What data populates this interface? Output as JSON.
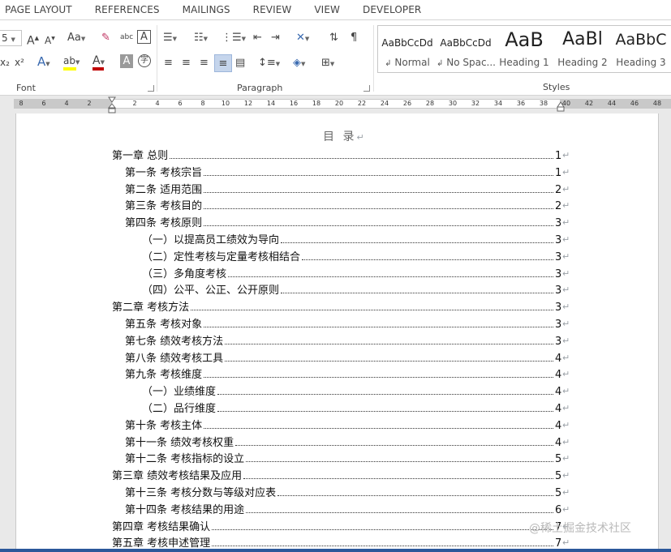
{
  "ribbon_tabs": [
    "PAGE LAYOUT",
    "REFERENCES",
    "MAILINGS",
    "REVIEW",
    "VIEW",
    "DEVELOPER"
  ],
  "font_group": {
    "label": "Font",
    "size_fragment": "5",
    "font_case": "Aa",
    "subscript": "x₂",
    "superscript": "x²"
  },
  "paragraph_group": {
    "label": "Paragraph"
  },
  "styles_group": {
    "label": "Styles",
    "items": [
      {
        "sample": "AaBbCcDd",
        "name": "Normal",
        "mark": "↲"
      },
      {
        "sample": "AaBbCcDd",
        "name": "No Spac...",
        "mark": "↲"
      },
      {
        "sample": "AaB",
        "name": "Heading 1",
        "mark": ""
      },
      {
        "sample": "AaBl",
        "name": "Heading 2",
        "mark": ""
      },
      {
        "sample": "AaBbC",
        "name": "Heading 3",
        "mark": ""
      }
    ]
  },
  "ruler_ticks": [
    "8",
    "6",
    "4",
    "2",
    "2",
    "4",
    "6",
    "8",
    "10",
    "12",
    "14",
    "16",
    "18",
    "20",
    "22",
    "24",
    "26",
    "28",
    "30",
    "32",
    "34",
    "36",
    "38",
    "40",
    "42",
    "44",
    "46",
    "48"
  ],
  "document": {
    "title": "目 录",
    "paragraph_mark": "↵",
    "toc": [
      {
        "text": "第一章  总则",
        "page": "1",
        "level": 1
      },
      {
        "text": "第一条  考核宗旨",
        "page": "1",
        "level": 2
      },
      {
        "text": "第二条  适用范围",
        "page": "2",
        "level": 2
      },
      {
        "text": "第三条  考核目的",
        "page": "2",
        "level": 2
      },
      {
        "text": "第四条  考核原则",
        "page": "3",
        "level": 2
      },
      {
        "text": "（一）以提高员工绩效为导向",
        "page": "3",
        "level": 3
      },
      {
        "text": "（二）定性考核与定量考核相结合",
        "page": "3",
        "level": 3
      },
      {
        "text": "（三）多角度考核",
        "page": "3",
        "level": 3
      },
      {
        "text": "（四）公平、公正、公开原则",
        "page": "3",
        "level": 3
      },
      {
        "text": "第二章  考核方法",
        "page": "3",
        "level": 1
      },
      {
        "text": "第五条  考核对象",
        "page": "3",
        "level": 2
      },
      {
        "text": "第七条  绩效考核方法",
        "page": "3",
        "level": 2
      },
      {
        "text": "第八条  绩效考核工具",
        "page": "4",
        "level": 2
      },
      {
        "text": "第九条  考核维度",
        "page": "4",
        "level": 2
      },
      {
        "text": "（一）业绩维度",
        "page": "4",
        "level": 3
      },
      {
        "text": "（二）品行维度",
        "page": "4",
        "level": 3
      },
      {
        "text": "第十条  考核主体",
        "page": "4",
        "level": 2
      },
      {
        "text": "第十一条  绩效考核权重",
        "page": "4",
        "level": 2
      },
      {
        "text": "第十二条  考核指标的设立",
        "page": "5",
        "level": 2
      },
      {
        "text": "第三章  绩效考核结果及应用",
        "page": "5",
        "level": 1
      },
      {
        "text": "第十三条  考核分数与等级对应表",
        "page": "5",
        "level": 2
      },
      {
        "text": "第十四条  考核结果的用途",
        "page": "6",
        "level": 2
      },
      {
        "text": "第四章  考核结果确认",
        "page": "7",
        "level": 1
      },
      {
        "text": "第五章  考核申述管理",
        "page": "7",
        "level": 1
      }
    ]
  },
  "watermark": "@稀土掘金技术社区",
  "colors": {
    "accent": "#2b579a",
    "font_color_bar": "#c00000",
    "highlight_bar": "#ffff00"
  }
}
